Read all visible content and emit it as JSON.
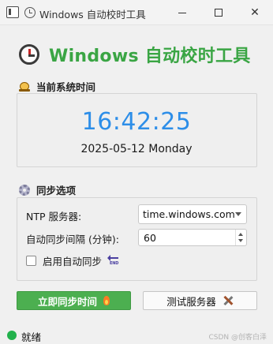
{
  "window": {
    "title": "Windows 自动校时工具",
    "minimize_label": "—",
    "close_label": "✕"
  },
  "header": {
    "title": "Windows 自动校时工具"
  },
  "current_time_section": {
    "label": "当前系统时间",
    "time": "16:42:25",
    "date": "2025-05-12 Monday"
  },
  "sync_section": {
    "label": "同步选项",
    "ntp_label": "NTP 服务器:",
    "ntp_value": "time.windows.com",
    "interval_label": "自动同步间隔 (分钟):",
    "interval_value": "60",
    "auto_sync_label": "启用自动同步",
    "auto_sync_checked": false,
    "end_icon_text": "END"
  },
  "buttons": {
    "sync_now": "立即同步时间",
    "test_server": "测试服务器"
  },
  "status": {
    "text": "就绪",
    "color": "#22b14c"
  },
  "watermark": "CSDN @创客白泽",
  "colors": {
    "accent_green": "#3aa544",
    "time_blue": "#2d8ee8",
    "button_green": "#4caf50"
  }
}
